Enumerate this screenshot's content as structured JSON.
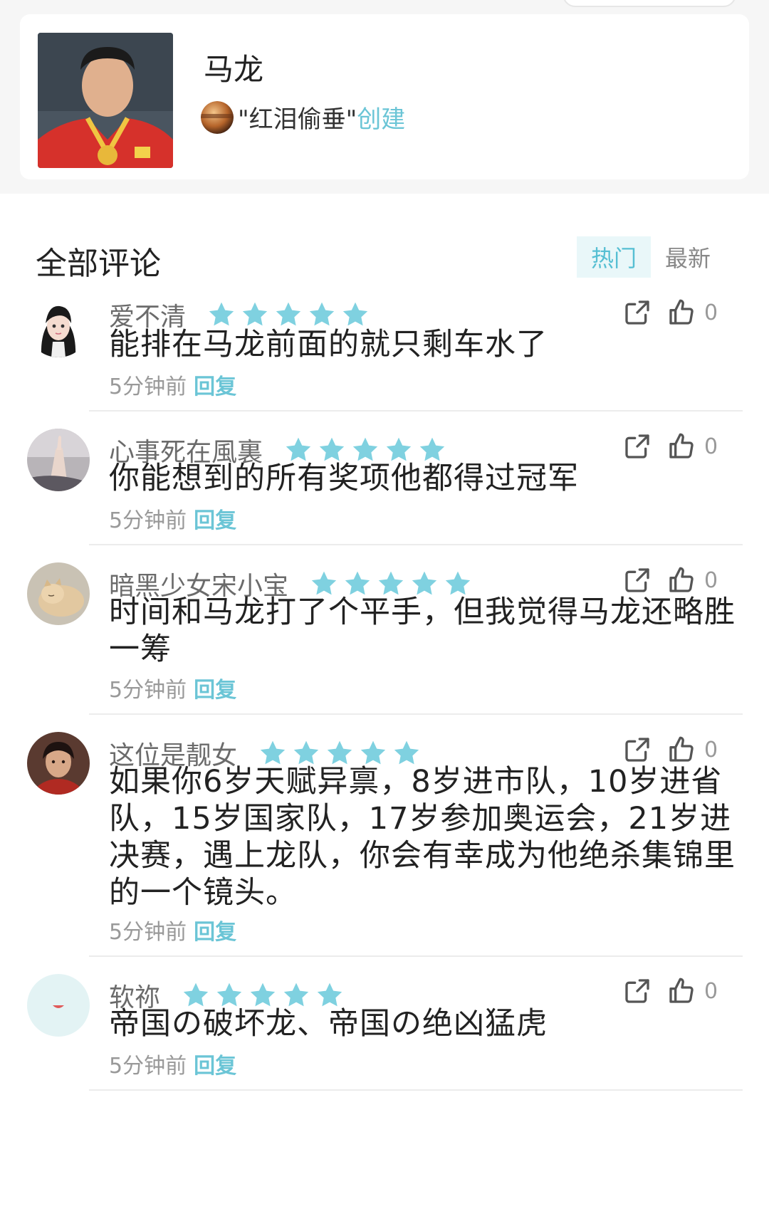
{
  "topic": {
    "title": "马龙",
    "creator_name": "\"红泪偷垂\"",
    "created_label": "创建"
  },
  "comments_section": {
    "title": "全部评论",
    "tabs": [
      {
        "label": "热门",
        "active": true
      },
      {
        "label": "最新",
        "active": false
      }
    ]
  },
  "colors": {
    "accent": "#6bc5d6",
    "star": "#7fd1e0"
  },
  "comments": [
    {
      "name": "爱不清",
      "text": "能排在马龙前面的就只剩车水了",
      "time": "5分钟前",
      "reply_label": "回复",
      "likes": "0",
      "stars": 5
    },
    {
      "name": "心事死在風裏",
      "text": "你能想到的所有奖项他都得过冠军",
      "time": "5分钟前",
      "reply_label": "回复",
      "likes": "0",
      "stars": 5
    },
    {
      "name": "暗黑少女宋小宝",
      "text": "时间和马龙打了个平手，但我觉得马龙还略胜一筹",
      "time": "5分钟前",
      "reply_label": "回复",
      "likes": "0",
      "stars": 5
    },
    {
      "name": "这位是靓女",
      "text": "如果你6岁天赋异禀，8岁进市队，10岁进省队，15岁国家队，17岁参加奥运会，21岁进决赛，遇上龙队，你会有幸成为他绝杀集锦里的一个镜头。",
      "time": "5分钟前",
      "reply_label": "回复",
      "likes": "0",
      "stars": 5
    },
    {
      "name": "软祢",
      "text": "帝国の破坏龙、帝国の绝凶猛虎",
      "time": "5分钟前",
      "reply_label": "回复",
      "likes": "0",
      "stars": 5
    }
  ]
}
